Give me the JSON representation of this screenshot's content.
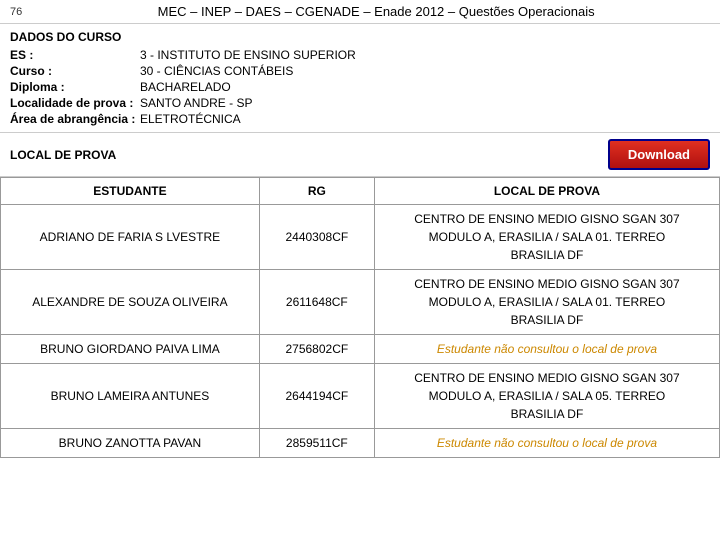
{
  "header": {
    "page_number": "76",
    "title": "MEC – INEP – DAES – CGENADE – Enade 2012 – Questões Operacionais"
  },
  "dados_do_curso": {
    "section_title": "DADOS DO CURSO",
    "fields": [
      {
        "label": "ES :",
        "value": "3 - INSTITUTO DE ENSINO SUPERIOR"
      },
      {
        "label": "Curso :",
        "value": "30 - CIÊNCIAS CONTÁBEIS"
      },
      {
        "label": "Diploma :",
        "value": "BACHARELADO"
      },
      {
        "label": "Localidade de prova :",
        "value": "SANTO ANDRE - SP"
      },
      {
        "label": "Área de abrangência :",
        "value": "ELETROTÉCNICA"
      }
    ]
  },
  "local_de_prova": {
    "title": "LOCAL DE PROVA",
    "download_label": "Download"
  },
  "table": {
    "headers": [
      "ESTUDANTE",
      "RG",
      "LOCAL DE PROVA"
    ],
    "rows": [
      {
        "estudante": "ADRIANO DE FARIA S LVESTRE",
        "rg": "2440308CF",
        "local": "CENTRO DE ENSINO MEDIO GISNO   SGAN 307\nMODULO A,  ERASILIA / SALA 01. TERREO\nBRASILIA   DF",
        "not_consulted": false
      },
      {
        "estudante": "ALEXANDRE DE SOUZA OLIVEIRA",
        "rg": "2611648CF",
        "local": "CENTRO DE ENSINO MEDIO GISNO   SGAN 307\nMODULO A,  ERASILIA / SALA 01. TERREO\nBRASILIA   DF",
        "not_consulted": false
      },
      {
        "estudante": "BRUNO GIORDANO PAIVA LIMA",
        "rg": "2756802CF",
        "local": "Estudante não consultou o local de prova",
        "not_consulted": true
      },
      {
        "estudante": "BRUNO LAMEIRA ANTUNES",
        "rg": "2644194CF",
        "local": "CENTRO DE ENSINO MEDIO GISNO   SGAN 307\nMODULO A,  ERASILIA / SALA 05. TERREO\nBRASILIA   DF",
        "not_consulted": false
      },
      {
        "estudante": "BRUNO ZANOTTA PAVAN",
        "rg": "2859511CF",
        "local": "Estudante não consultou o local de prova",
        "not_consulted": true
      }
    ]
  }
}
